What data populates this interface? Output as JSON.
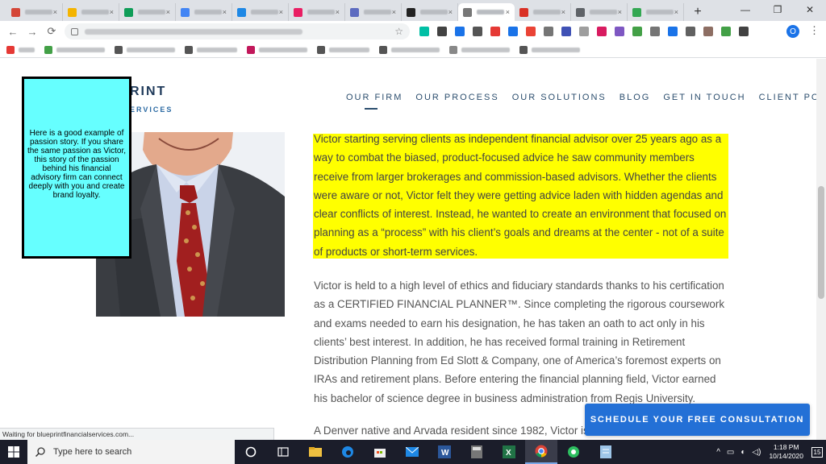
{
  "browser": {
    "tabs": [
      {
        "icon": "gmail-icon",
        "color": "#d44638"
      },
      {
        "icon": "folder-icon",
        "color": "#f4b400"
      },
      {
        "icon": "site-icon",
        "color": "#0f9d58"
      },
      {
        "icon": "doc-icon",
        "color": "#4285f4"
      },
      {
        "icon": "site-icon",
        "color": "#1e88e5"
      },
      {
        "icon": "site-icon",
        "color": "#e91e63"
      },
      {
        "icon": "site-icon",
        "color": "#5c6bc0"
      },
      {
        "icon": "site-icon",
        "color": "#222222"
      },
      {
        "icon": "site-icon",
        "color": "#777777",
        "active": true
      },
      {
        "icon": "site-icon",
        "color": "#d93025"
      },
      {
        "icon": "site-icon",
        "color": "#5f6368"
      },
      {
        "icon": "site-icon",
        "color": "#34a853"
      }
    ],
    "new_tab": "+",
    "window_controls": {
      "minimize": "—",
      "restore": "❐",
      "close": "✕"
    },
    "nav": {
      "back": "←",
      "forward": "→",
      "reload": "⟳"
    },
    "profile_initial": "O",
    "extension_colors": [
      "#00bfa5",
      "#424242",
      "#1a73e8",
      "#555555",
      "#e53935",
      "#1a73e8",
      "#ea4335",
      "#757575",
      "#3f51b5",
      "#9e9e9e",
      "#d81b60",
      "#7e57c2",
      "#43a047",
      "#757575",
      "#1a73e8",
      "#616161",
      "#8d6e63",
      "#43a047",
      "#424242"
    ],
    "bookmark_colors": [
      "#e53935",
      "#43a047",
      "#555555",
      "#555555",
      "#c2185b",
      "#555555",
      "#555555",
      "#888888",
      "#555555"
    ]
  },
  "site": {
    "logo_top": "RINT",
    "logo_bottom": "ERVICES",
    "nav": [
      "OUR FIRM",
      "OUR PROCESS",
      "OUR SOLUTIONS",
      "BLOG",
      "GET IN TOUCH",
      "CLIENT PORTAL"
    ]
  },
  "callout": {
    "text": "Here is a good example of passion story. If you share the same passion as Victor, this story of the passion behind his financial advisory firm can connect deeply with you and create brand loyalty."
  },
  "content": {
    "paragraph1": "Victor starting serving clients as independent financial advisor over 25 years ago as a way to combat the biased, product-focused advice he saw community members receive from larger brokerages and commission-based advisors. Whether the clients were aware or not, Victor felt they were getting advice laden with hidden agendas and clear conflicts of interest.  Instead, he wanted to create an environment that focused on planning as a “process” with his client’s goals and dreams at the center - not of a suite of products or short-term services.",
    "paragraph2": "Victor is held to a high level of ethics and fiduciary standards thanks to his certification as a CERTIFIED FINANCIAL PLANNER™. Since completing the rigorous coursework and exams needed to earn his designation, he has taken an oath to act only in his clients’ best interest. In addition, he has received formal training in Retirement Distribution Planning from Ed Slott & Company, one of America’s foremost experts on IRAs and retirement plans. Before entering the financial planning field, Victor earned his bachelor of science degree in business administration from Regis University.",
    "paragraph3": "A Denver native and Arvada resident since 1982, Victor is",
    "cta": "SCHEDULE YOUR FREE CONSULTATION"
  },
  "status_bar": "Waiting for blueprintfinancialservices.com...",
  "taskbar": {
    "search_placeholder": "Type here to search",
    "time": "1:18 PM",
    "date": "10/14/2020",
    "notification_count": "15"
  }
}
